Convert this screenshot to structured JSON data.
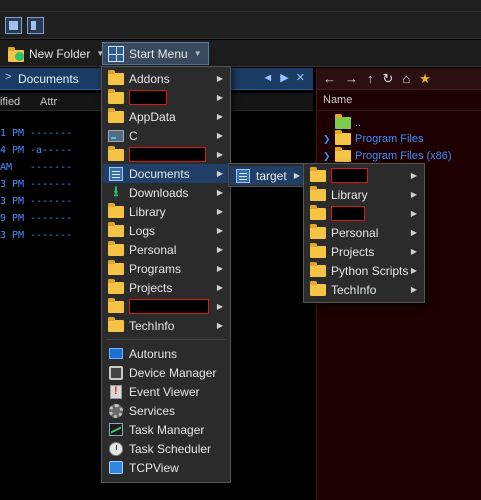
{
  "toolbar": {
    "new_folder_label": "New Folder",
    "start_menu_label": "Start Menu"
  },
  "left_pane": {
    "path_label": "Documents",
    "columns": {
      "modified": "ified",
      "attr": "Attr"
    },
    "rows": [
      {
        "time": "1 PM",
        "attr": "-------"
      },
      {
        "time": "4 PM",
        "attr": "-a-----"
      },
      {
        "time": "AM",
        "attr": "-------"
      },
      {
        "time": "3 PM",
        "attr": "-------"
      },
      {
        "time": "3 PM",
        "attr": "-------"
      },
      {
        "time": "9 PM",
        "attr": "-------"
      },
      {
        "time": "3 PM",
        "attr": "-------"
      }
    ]
  },
  "right_pane": {
    "name_header": "Name",
    "parent_label": "..",
    "tree": [
      {
        "label": "Program Files"
      },
      {
        "label": "Program Files (x86)"
      }
    ]
  },
  "start_menu": {
    "items": [
      {
        "label": "Addons"
      },
      {
        "label": ""
      },
      {
        "label": "AppData"
      },
      {
        "label": "C"
      },
      {
        "label": ""
      },
      {
        "label": "Documents"
      },
      {
        "label": "Downloads"
      },
      {
        "label": "Library"
      },
      {
        "label": "Logs"
      },
      {
        "label": "Personal"
      },
      {
        "label": "Programs"
      },
      {
        "label": "Projects"
      },
      {
        "label": ""
      },
      {
        "label": "TechInfo"
      }
    ],
    "apps": [
      {
        "label": "Autoruns"
      },
      {
        "label": "Device Manager"
      },
      {
        "label": "Event Viewer"
      },
      {
        "label": "Services"
      },
      {
        "label": "Task Manager"
      },
      {
        "label": "Task Scheduler"
      },
      {
        "label": "TCPView"
      }
    ]
  },
  "documents_submenu": {
    "items": [
      {
        "label": "target"
      }
    ]
  },
  "target_submenu": {
    "items": [
      {
        "label": ""
      },
      {
        "label": "Library"
      },
      {
        "label": ""
      },
      {
        "label": "Personal"
      },
      {
        "label": "Projects"
      },
      {
        "label": "Python Scripts"
      },
      {
        "label": "TechInfo"
      }
    ]
  },
  "colors": {
    "accent_blue": "#3d8bff",
    "highlight": "#1f3f66",
    "redaction": "#d11b1b",
    "folder": "#f6c444"
  }
}
